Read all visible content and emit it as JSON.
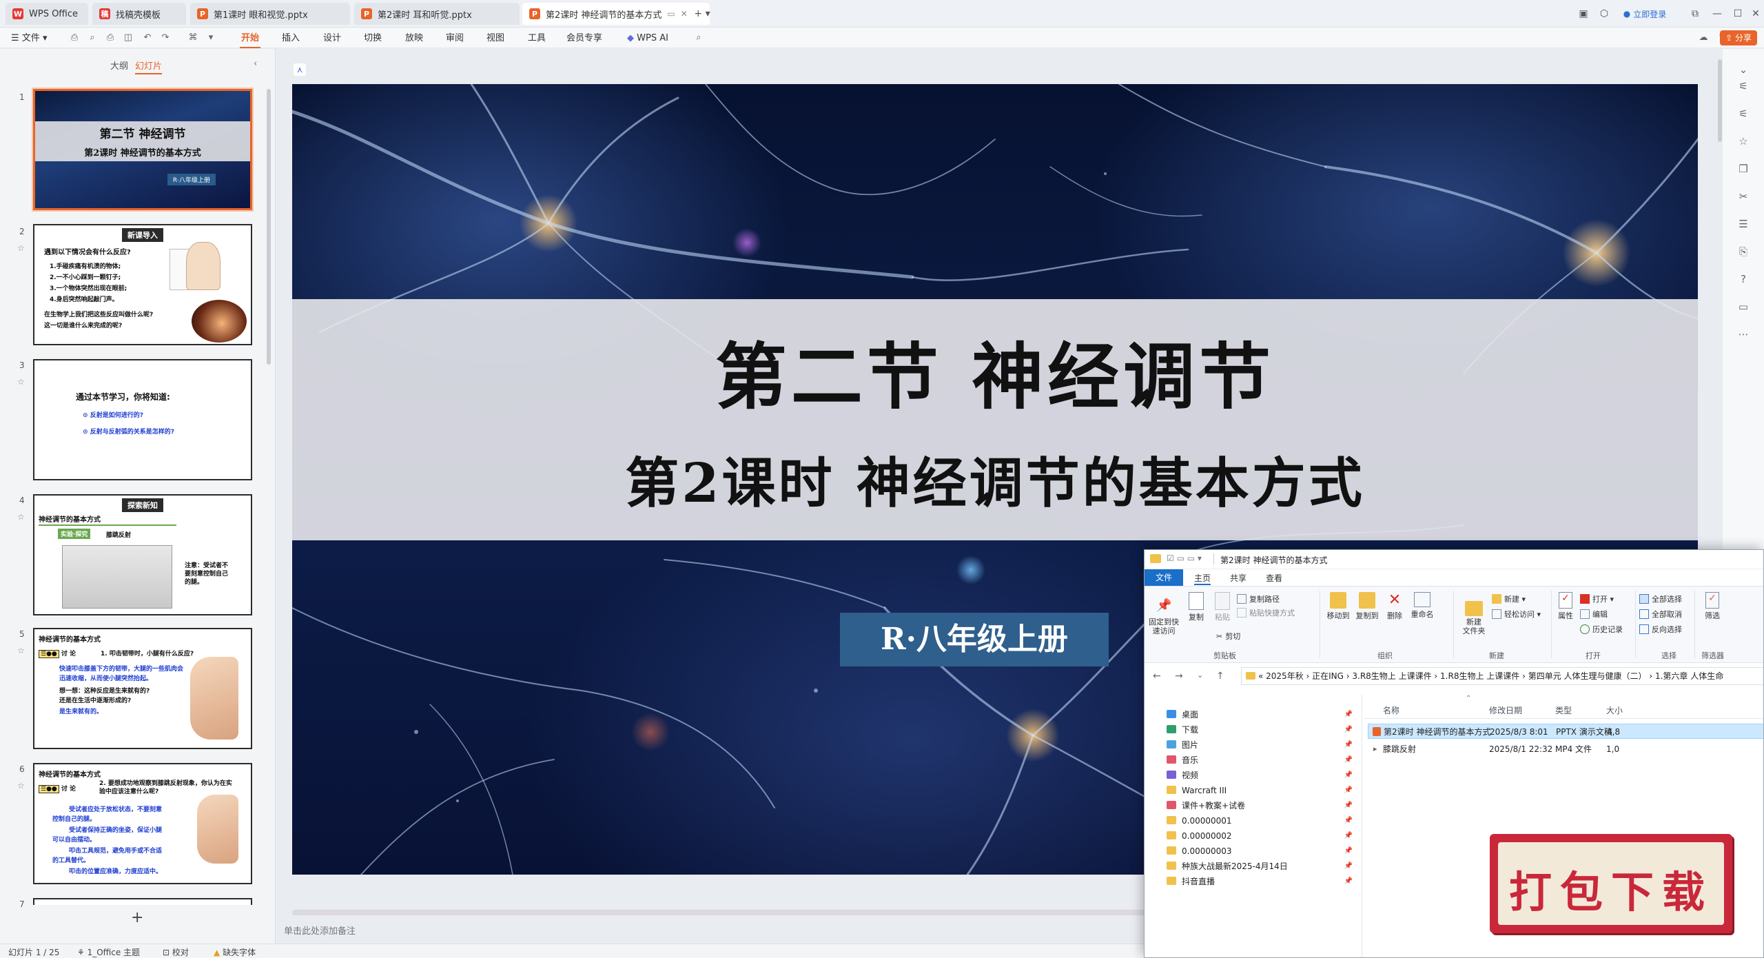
{
  "tabs": [
    {
      "label": "WPS Office",
      "icon": "wps-logo-icon"
    },
    {
      "label": "找稿壳模板",
      "icon": "template-icon"
    },
    {
      "label": "第1课时 眼和视觉.pptx",
      "icon": "pptx-icon"
    },
    {
      "label": "第2课时 耳和听觉.pptx",
      "icon": "pptx-icon"
    },
    {
      "label": "第2课时 神经调节的基本方式",
      "icon": "pptx-icon"
    }
  ],
  "titlebar": {
    "login": "立即登录"
  },
  "menu": {
    "file": "文件",
    "items": [
      "开始",
      "插入",
      "设计",
      "切换",
      "放映",
      "审阅",
      "视图",
      "工具",
      "会员专享",
      "WPS AI"
    ],
    "active": "开始",
    "share": "分享"
  },
  "panel": {
    "tab_outline": "大纲",
    "tab_slides": "幻灯片",
    "add": "+"
  },
  "thumbs": {
    "t1": {
      "num": "1",
      "title": "第二节  神经调节",
      "subtitle": "第2课时 神经调节的基本方式",
      "label": "R·八年级上册"
    },
    "t2": {
      "num": "2",
      "badge": "新课导入",
      "q": "遇到以下情况会有什么反应?",
      "l1": "1.手碰疾痛有机渍的物体;",
      "l2": "2.一不小心踩到一颗钉子;",
      "l3": "3.一个物体突然出现在眼前;",
      "l4": "4.身后突然响起敲门声。",
      "l5": "在生物学上我们把这些反应叫做什么呢?",
      "l6": "这一切是谁什么来完成的呢?"
    },
    "t3": {
      "num": "3",
      "head": "通过本节学习，你将知道:",
      "q1": "反射是如何进行的?",
      "q2": "反射与反射弧的关系是怎样的?"
    },
    "t4": {
      "num": "4",
      "badge": "探索新知",
      "head": "神经调节的基本方式",
      "tag": "实验·探究",
      "tagtext": "膝跳反射",
      "note": "注意：受试者不要刻意控制自己的腿。"
    },
    "t5": {
      "num": "5",
      "head": "神经调节的基本方式",
      "d": "讨 论",
      "q": "1. 叩击韧带时，小腿有什么反应?",
      "a1": "快速叩击膝盖下方的韧带，大腿的一些肌肉会",
      "a2": "迅速收缩，从而使小腿突然抬起。",
      "a3": "想一想：这种反应是生来就有的?",
      "a4": "还是在生活中逐渐形成的?",
      "a5": "是生来就有的。"
    },
    "t6": {
      "num": "6",
      "head": "神经调节的基本方式",
      "d": "讨 论",
      "q": "2. 要想成功地观察到膝跳反射现象，你认为在实验中应该注意什么呢?",
      "a1": "受试者应处于放松状态，不要刻意",
      "a2": "控制自己的腿。",
      "a3": "受试者保持正确的坐姿，保证小腿",
      "a4": "可以自由摆动。",
      "a5": "叩击工具规范，避免用手或不合适",
      "a6": "的工具替代。",
      "a7": "叩击的位置应准确，力度应适中。"
    },
    "t7": {
      "num": "7"
    }
  },
  "slide": {
    "title": "第二节  神经调节",
    "subtitle": "第2课时 神经调节的基本方式",
    "grade": "R·八年级上册"
  },
  "notes_placeholder": "单击此处添加备注",
  "status": {
    "slide_count": "幻灯片 1 / 25",
    "theme": "1_Office 主题",
    "proof": "校对",
    "missing_font": "缺失字体"
  },
  "explorer": {
    "title": "第2课时 神经调节的基本方式",
    "tabs": {
      "file": "文件",
      "home": "主页",
      "share": "共享",
      "view": "查看"
    },
    "ribbon": {
      "pin": "固定到快\n速访问",
      "copy": "复制",
      "paste": "粘贴",
      "copy_path": "复制路径",
      "paste_shortcut": "粘贴快捷方式",
      "cut": "剪切",
      "move_to": "移动到",
      "copy_to": "复制到",
      "delete": "删除",
      "rename": "重命名",
      "new_folder": "新建\n文件夹",
      "new_item": "新建 ▾",
      "easy_access": "轻松访问 ▾",
      "properties": "属性",
      "open": "打开 ▾",
      "edit": "编辑",
      "history": "历史记录",
      "select_all": "全部选择",
      "select_none": "全部取消",
      "invert": "反向选择",
      "filter": "筛选",
      "groups": {
        "clipboard": "剪贴板",
        "organize": "组织",
        "new": "新建",
        "open": "打开",
        "select": "选择",
        "filter": "筛选器"
      }
    },
    "path": "«  2025年秋  ›  正在ING  ›  3.R8生物上 上课课件  ›  1.R8生物上 上课课件  ›  第四单元 人体生理与健康（二）  ›  1.第六章 人体生命",
    "nav": [
      {
        "label": "桌面",
        "color": "#3a8ee6"
      },
      {
        "label": "下载",
        "color": "#2f9e6b"
      },
      {
        "label": "图片",
        "color": "#4aa3df"
      },
      {
        "label": "音乐",
        "color": "#e0566b"
      },
      {
        "label": "视频",
        "color": "#7b5fd6"
      },
      {
        "label": "Warcraft III",
        "color": "#f0c24b"
      },
      {
        "label": "课件+教案+试卷",
        "color": "#e0566b"
      },
      {
        "label": "0.00000001",
        "color": "#f0c24b"
      },
      {
        "label": "0.00000002",
        "color": "#f0c24b"
      },
      {
        "label": "0.00000003",
        "color": "#f0c24b"
      },
      {
        "label": "种族大战最新2025-4月14日",
        "color": "#f0c24b"
      },
      {
        "label": "抖音直播",
        "color": "#f0c24b"
      }
    ],
    "columns": {
      "name": "名称",
      "date": "修改日期",
      "type": "类型",
      "size": "大小"
    },
    "files": [
      {
        "name": "第2课时 神经调节的基本方式",
        "date": "2025/8/3 8:01",
        "type": "PPTX 演示文稿",
        "size": "4,8"
      },
      {
        "name": "膝跳反射",
        "date": "2025/8/1 22:32",
        "type": "MP4 文件",
        "size": "1,0"
      }
    ]
  },
  "banner": {
    "text": "打包下载"
  },
  "colors": {
    "accent": "#e8642a",
    "slide_label": "#2f5f8c",
    "banner": "#c9283a",
    "explorer_blue": "#1a6fc8"
  }
}
